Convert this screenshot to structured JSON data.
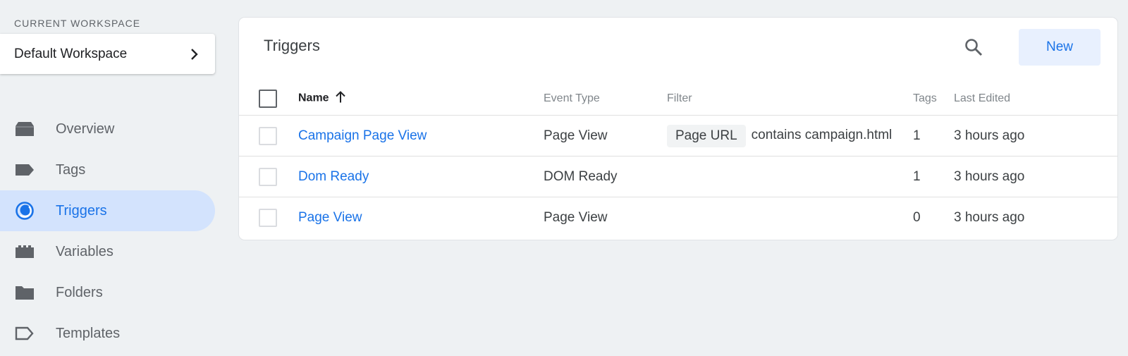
{
  "workspace": {
    "label": "CURRENT WORKSPACE",
    "name": "Default Workspace"
  },
  "nav": {
    "items": [
      {
        "label": "Overview",
        "icon": "overview-icon"
      },
      {
        "label": "Tags",
        "icon": "tag-icon"
      },
      {
        "label": "Triggers",
        "icon": "trigger-icon",
        "active": true
      },
      {
        "label": "Variables",
        "icon": "variables-icon"
      },
      {
        "label": "Folders",
        "icon": "folder-icon"
      },
      {
        "label": "Templates",
        "icon": "template-icon"
      }
    ]
  },
  "triggers": {
    "title": "Triggers",
    "new_label": "New",
    "columns": {
      "name": "Name",
      "event_type": "Event Type",
      "filter": "Filter",
      "tags": "Tags",
      "last_edited": "Last Edited"
    },
    "rows": [
      {
        "name": "Campaign Page View",
        "event_type": "Page View",
        "filter_chip": "Page URL",
        "filter_text": "contains campaign.html",
        "tags": "1",
        "last_edited": "3 hours ago"
      },
      {
        "name": "Dom Ready",
        "event_type": "DOM Ready",
        "filter_chip": "",
        "filter_text": "",
        "tags": "1",
        "last_edited": "3 hours ago"
      },
      {
        "name": "Page View",
        "event_type": "Page View",
        "filter_chip": "",
        "filter_text": "",
        "tags": "0",
        "last_edited": "3 hours ago"
      }
    ]
  },
  "colors": {
    "accent": "#1a73e8",
    "active_nav_bg": "#d3e3fd",
    "page_bg": "#eef1f3",
    "new_button_bg": "#e8f0fe"
  }
}
